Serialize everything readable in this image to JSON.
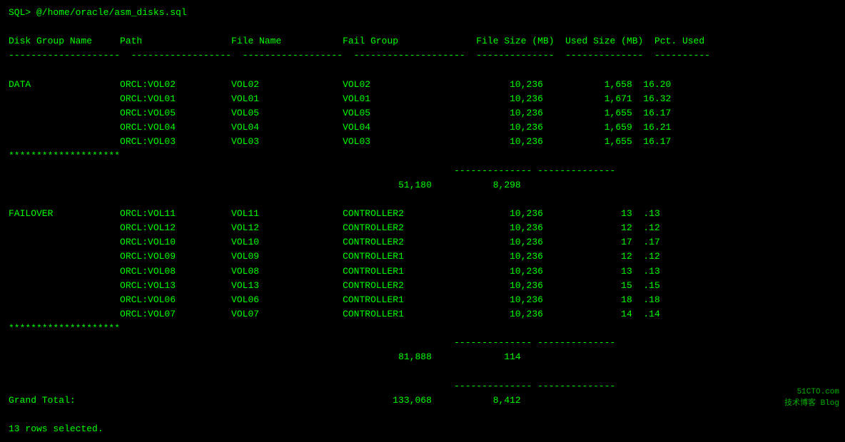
{
  "terminal": {
    "prompt_line": "SQL> @/home/oracle/asm_disks.sql",
    "header": {
      "col1": "Disk Group Name",
      "col2": "Path",
      "col3": "File Name",
      "col4": "Fail Group",
      "col5": "File Size (MB)",
      "col6": "Used Size (MB)",
      "col7": "Pct. Used"
    },
    "separator": "--------------------  ------------------  ------------------  ------------------  --------------  --------------  ----------",
    "data_section": [
      {
        "group": "DATA",
        "path": "ORCL:VOL02",
        "file": "VOL02",
        "fail": "VOL02",
        "filesize": "10,236",
        "usedsize": "1,658",
        "pct": "16.20"
      },
      {
        "group": "",
        "path": "ORCL:VOL01",
        "file": "VOL01",
        "fail": "VOL01",
        "filesize": "10,236",
        "usedsize": "1,671",
        "pct": "16.32"
      },
      {
        "group": "",
        "path": "ORCL:VOL05",
        "file": "VOL05",
        "fail": "VOL05",
        "filesize": "10,236",
        "usedsize": "1,655",
        "pct": "16.17"
      },
      {
        "group": "",
        "path": "ORCL:VOL04",
        "file": "VOL04",
        "fail": "VOL04",
        "filesize": "10,236",
        "usedsize": "1,659",
        "pct": "16.21"
      },
      {
        "group": "",
        "path": "ORCL:VOL03",
        "file": "VOL03",
        "fail": "VOL03",
        "filesize": "10,236",
        "usedsize": "1,655",
        "pct": "16.17"
      }
    ],
    "data_stars": "********************",
    "data_subtotal_sep": "              --------------  --------------",
    "data_subtotal": {
      "filesize": "51,180",
      "usedsize": "8,298"
    },
    "failover_section": [
      {
        "group": "FAILOVER",
        "path": "ORCL:VOL11",
        "file": "VOL11",
        "fail": "CONTROLLER2",
        "filesize": "10,236",
        "usedsize": "13",
        "pct": ".13"
      },
      {
        "group": "",
        "path": "ORCL:VOL12",
        "file": "VOL12",
        "fail": "CONTROLLER2",
        "filesize": "10,236",
        "usedsize": "12",
        "pct": ".12"
      },
      {
        "group": "",
        "path": "ORCL:VOL10",
        "file": "VOL10",
        "fail": "CONTROLLER2",
        "filesize": "10,236",
        "usedsize": "17",
        "pct": ".17"
      },
      {
        "group": "",
        "path": "ORCL:VOL09",
        "file": "VOL09",
        "fail": "CONTROLLER1",
        "filesize": "10,236",
        "usedsize": "12",
        "pct": ".12"
      },
      {
        "group": "",
        "path": "ORCL:VOL08",
        "file": "VOL08",
        "fail": "CONTROLLER1",
        "filesize": "10,236",
        "usedsize": "13",
        "pct": ".13"
      },
      {
        "group": "",
        "path": "ORCL:VOL13",
        "file": "VOL13",
        "fail": "CONTROLLER2",
        "filesize": "10,236",
        "usedsize": "15",
        "pct": ".15"
      },
      {
        "group": "",
        "path": "ORCL:VOL06",
        "file": "VOL06",
        "fail": "CONTROLLER1",
        "filesize": "10,236",
        "usedsize": "18",
        "pct": ".18"
      },
      {
        "group": "",
        "path": "ORCL:VOL07",
        "file": "VOL07",
        "fail": "CONTROLLER1",
        "filesize": "10,236",
        "usedsize": "14",
        "pct": ".14"
      }
    ],
    "failover_stars": "********************",
    "failover_subtotal_sep": "              --------------  --------------",
    "failover_subtotal": {
      "filesize": "81,888",
      "usedsize": "114"
    },
    "grand_sep": "              --------------  --------------",
    "grand_total_label": "Grand Total:",
    "grand_total": {
      "filesize": "133,068",
      "usedsize": "8,412"
    },
    "footer": "13 rows selected.",
    "watermark_line1": "51CTO.com",
    "watermark_line2": "技术博客  Blog"
  }
}
